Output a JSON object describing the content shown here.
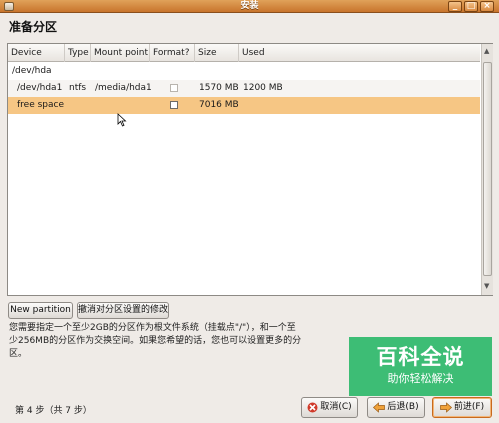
{
  "window": {
    "title": "安装"
  },
  "page_title": "准备分区",
  "table": {
    "columns": [
      "Device",
      "Type",
      "Mount point",
      "Format?",
      "Size",
      "Used"
    ],
    "rows": [
      {
        "device": "/dev/hda",
        "type": "",
        "mount": "",
        "format": null,
        "size": "",
        "used": ""
      },
      {
        "device": "/dev/hda1",
        "type": "ntfs",
        "mount": "/media/hda1",
        "format": false,
        "size": "1570 MB",
        "used": "1200 MB"
      },
      {
        "device": "free space",
        "type": "",
        "mount": "",
        "format": false,
        "size": "7016 MB",
        "used": "",
        "selected": true
      }
    ]
  },
  "buttons": {
    "new_partition": "New partition",
    "undo_changes": "撤消对分区设置的修改",
    "cancel": "取消(C)",
    "back": "后退(B)",
    "forward": "前进(F)"
  },
  "info_lines": [
    "您需要指定一个至少2GB的分区作为根文件系统（挂载点\"/\"），和一个至",
    "少256MB的分区作为交换空间。如果您希望的话，您也可以设置更多的分",
    "区。"
  ],
  "step": "第 4 步（共 7 步）",
  "watermark": {
    "title": "百科全说",
    "subtitle": "助你轻松解决"
  },
  "colors": {
    "accent": "#c8742c",
    "selection": "#f6c684",
    "watermark": "#3dbd75"
  }
}
